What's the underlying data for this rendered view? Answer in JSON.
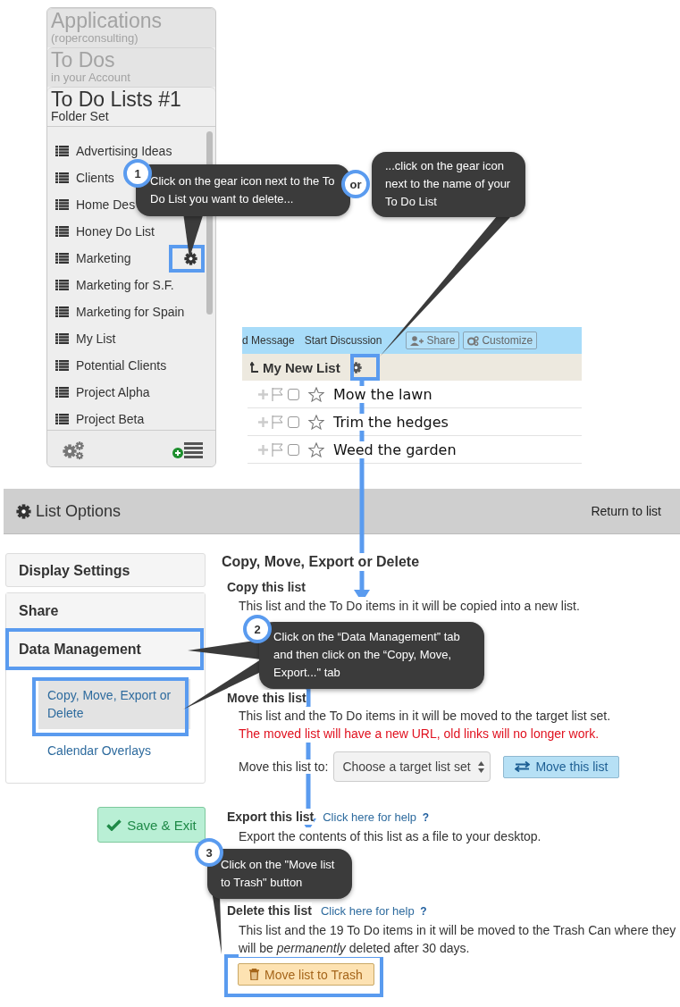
{
  "sidebar": {
    "breadcrumbs": [
      {
        "title": "Applications",
        "subtitle": "(roperconsulting)",
        "current": false
      },
      {
        "title": "To Dos",
        "subtitle": "in your Account",
        "current": false
      },
      {
        "title": "To Do Lists #1",
        "subtitle": "Folder Set",
        "current": true
      }
    ],
    "lists": [
      {
        "name": "Advertising Ideas",
        "hovered": false
      },
      {
        "name": "Clients",
        "hovered": false
      },
      {
        "name": "Home Des",
        "hovered": false
      },
      {
        "name": "Honey Do List",
        "hovered": false
      },
      {
        "name": "Marketing",
        "hovered": true
      },
      {
        "name": "Marketing for S.F.",
        "hovered": false
      },
      {
        "name": "Marketing for Spain",
        "hovered": false
      },
      {
        "name": "My List",
        "hovered": false
      },
      {
        "name": "Potential Clients",
        "hovered": false
      },
      {
        "name": "Project Alpha",
        "hovered": false
      },
      {
        "name": "Project Beta",
        "hovered": false
      }
    ]
  },
  "list_view": {
    "toolbar": [
      {
        "label": "d Message",
        "kind": "link"
      },
      {
        "label": "Start Discussion",
        "kind": "link"
      },
      {
        "label": "Share",
        "kind": "button"
      },
      {
        "label": "Customize",
        "kind": "button"
      }
    ],
    "title": "My New List",
    "items": [
      {
        "text": "Mow the lawn",
        "checked": false,
        "starred": false
      },
      {
        "text": "Trim the hedges",
        "checked": false,
        "starred": false
      },
      {
        "text": "Weed the garden",
        "checked": false,
        "starred": false
      }
    ]
  },
  "list_options": {
    "title": "List Options",
    "return_link": "Return to list",
    "tabs": [
      {
        "label": "Display Settings"
      },
      {
        "label": "Share"
      },
      {
        "label": "Data Management",
        "children": [
          {
            "label": "Copy, Move, Export or Delete",
            "selected": true
          },
          {
            "label": "Calendar Overlays",
            "selected": false
          }
        ]
      }
    ],
    "save_button": "Save & Exit",
    "heading": "Copy, Move, Export or Delete",
    "copy": {
      "heading": "Copy this list",
      "description": "This list and the To Do items in it will be copied into a new list."
    },
    "move": {
      "heading": "Move this list",
      "description": "This list and the To Do items in it will be moved to the target list set.",
      "warning": "The moved list will have a new URL, old links will no longer work.",
      "field_label": "Move this list to:",
      "select_placeholder": "Choose a target list set",
      "button": "Move this list"
    },
    "export": {
      "heading": "Export this list",
      "help_link": "Click here for help",
      "help_mark": "?",
      "description": "Export the contents of this list as a file to your desktop."
    },
    "delete": {
      "heading": "Delete this list",
      "help_link": "Click here for help",
      "help_mark": "?",
      "description": "This list and the 19 To Do items in it will be moved to the Trash Can where they will be *permanently* deleted after 30 days.",
      "button": "Move list to Trash"
    }
  },
  "annotations": {
    "callouts": [
      {
        "badge": "1",
        "text": "Click on the gear icon next to the To Do List you want to delete..."
      },
      {
        "badge": "or",
        "text": "...click on the gear icon next to the name of your To Do List"
      },
      {
        "badge": "2",
        "text": "Click on the “Data Management” tab and then click on the “Copy, Move, Export...\" tab"
      },
      {
        "badge": "3",
        "text": "Click on the \"Move list to Trash\" button"
      }
    ]
  }
}
